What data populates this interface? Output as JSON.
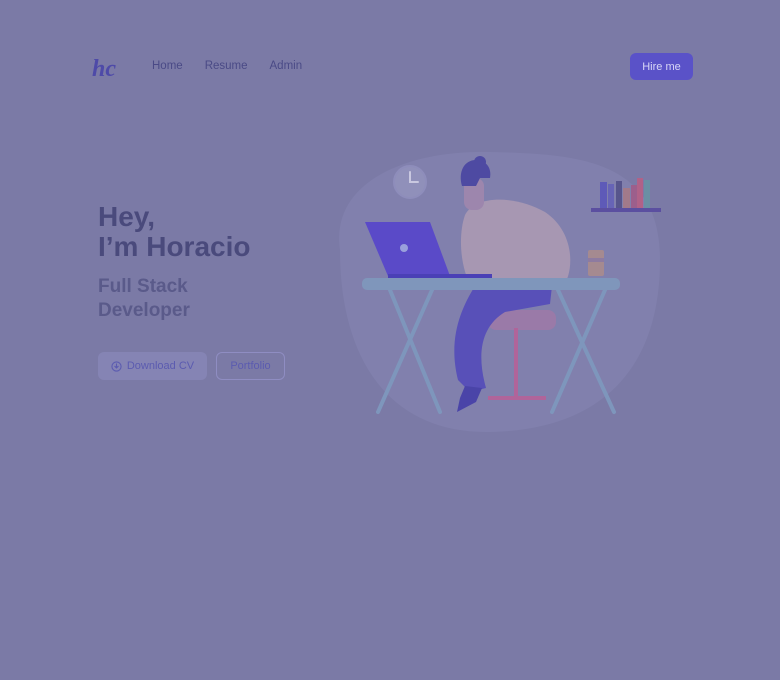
{
  "logo": {
    "text": "hc"
  },
  "nav": [
    "Home",
    "Resume",
    "Admin"
  ],
  "header": {
    "cta_label": "Hire me"
  },
  "hero": {
    "greeting_line1": "Hey,",
    "greeting_line2": "I’m Horacio",
    "subtitle_line1": "Full Stack",
    "subtitle_line2": "Developer",
    "download_label": "Download CV",
    "portfolio_label": "Portfolio"
  },
  "icons": {
    "logo": "hc-logo-icon",
    "download": "download-icon",
    "illustration": "developer-at-desk-illustration"
  },
  "colors": {
    "overlay": "#7b7aa6",
    "accent": "#5a52c8",
    "text": "#4a4a7c"
  }
}
